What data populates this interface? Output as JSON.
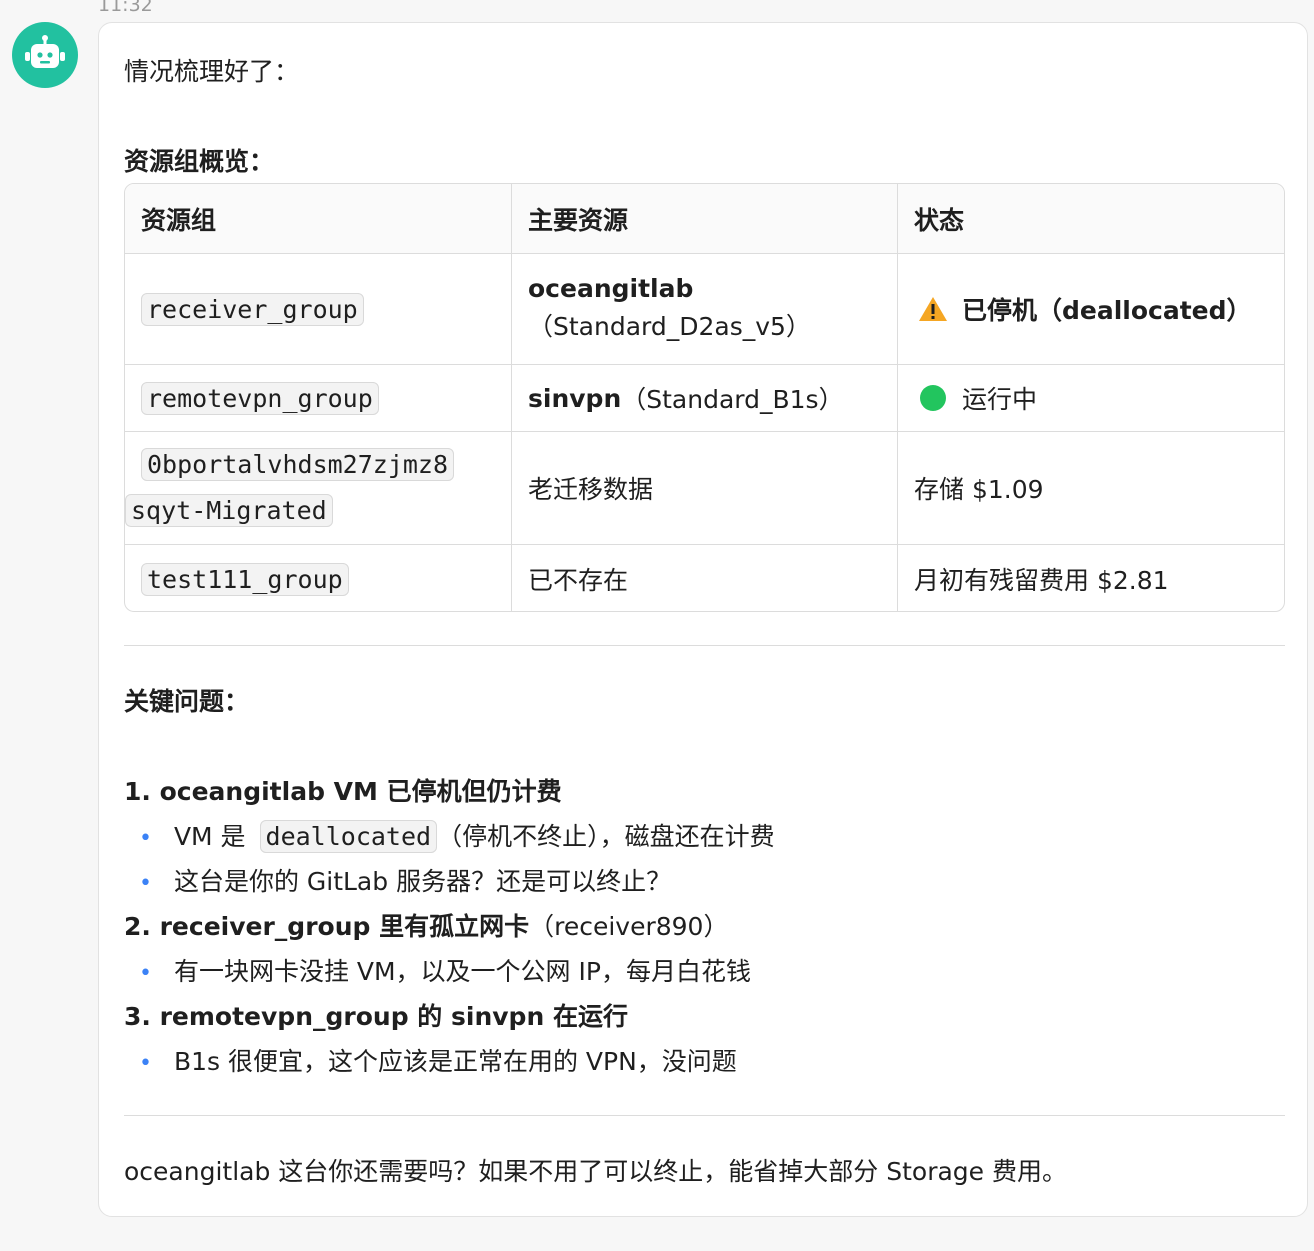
{
  "message": {
    "time": "11:32",
    "intro": "情况梳理好了：",
    "overview_heading": "资源组概览：",
    "table": {
      "headers": [
        "资源组",
        "主要资源",
        "状态"
      ],
      "rows": [
        {
          "group": "receiver_group",
          "resource_bold": "oceangitlab",
          "resource_note": "（Standard_D2as_v5）",
          "status": "已停机（deallocated）",
          "status_icon": "warning-icon"
        },
        {
          "group": "remotevpn_group",
          "resource_bold": "sinvpn",
          "resource_note": "（Standard_B1s）",
          "status": "运行中",
          "status_icon": "green-dot-icon"
        },
        {
          "group_line1": "0bportalvhdsm27zjmz8",
          "group_line2": "sqyt-Migrated",
          "resource": "老迁移数据",
          "status": "存储 $1.09"
        },
        {
          "group": "test111_group",
          "resource": "已不存在",
          "status": "月初有残留费用 $2.81"
        }
      ]
    },
    "issues_heading": "关键问题：",
    "issues": [
      {
        "title": "1. oceangitlab VM 已停机但仍计费",
        "bullets": [
          {
            "pre": "VM 是",
            "code": "deallocated",
            "post": "（停机不终止），磁盘还在计费"
          },
          {
            "text": "这台是你的 GitLab 服务器？还是可以终止？"
          }
        ]
      },
      {
        "title": "2. receiver_group 里有孤立网卡",
        "title_note": "（receiver890）",
        "bullets": [
          {
            "text": "有一块网卡没挂 VM，以及一个公网 IP，每月白花钱"
          }
        ]
      },
      {
        "title": "3. remotevpn_group 的 sinvpn 在运行",
        "bullets": [
          {
            "text": "B1s 很便宜，这个应该是正常在用的 VPN，没问题"
          }
        ]
      }
    ],
    "closing": "oceangitlab 这台你还需要吗？如果不用了可以终止，能省掉大部分 Storage 费用。"
  },
  "colors": {
    "avatar": "#22c1a0",
    "bullet": "#3b82f6",
    "running": "#22c55e",
    "warning": "#f5a623"
  }
}
